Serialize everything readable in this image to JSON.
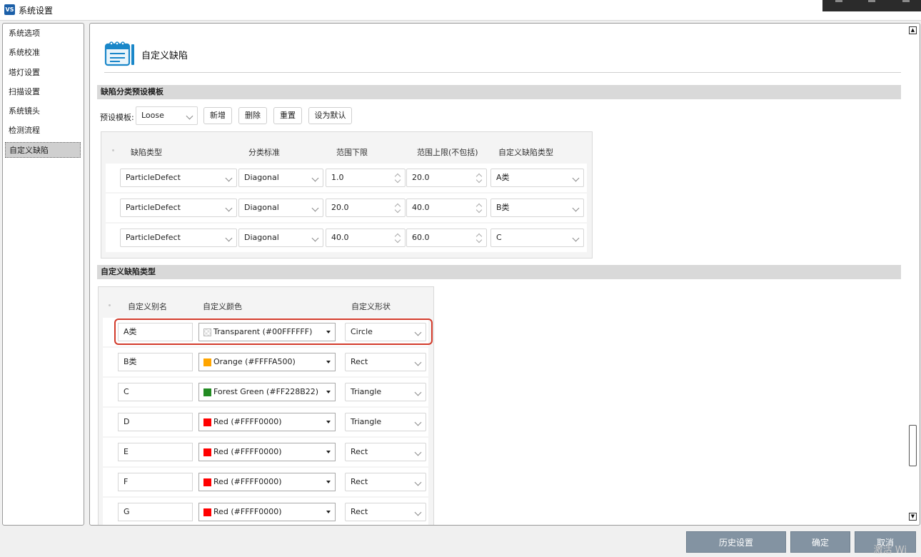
{
  "window": {
    "title": "系统设置",
    "app_badge": "VS"
  },
  "sidebar": {
    "items": [
      {
        "label": "系统选项",
        "active": false
      },
      {
        "label": "系统校准",
        "active": false
      },
      {
        "label": "塔灯设置",
        "active": false
      },
      {
        "label": "扫描设置",
        "active": false
      },
      {
        "label": "系统镜头",
        "active": false
      },
      {
        "label": "检测流程",
        "active": false
      },
      {
        "label": "自定义缺陷",
        "active": true
      }
    ]
  },
  "page": {
    "title": "自定义缺陷",
    "icon": "notepad-icon"
  },
  "preset_section": {
    "title": "缺陷分类预设模板",
    "template_label": "预设模板:",
    "template_value": "Loose",
    "buttons": {
      "add": "新增",
      "delete": "删除",
      "reset": "重置",
      "set_default": "设为默认"
    },
    "columns": [
      "缺陷类型",
      "分类标准",
      "范围下限",
      "范围上限(不包括)",
      "自定义缺陷类型"
    ],
    "rows": [
      {
        "defect_type": "ParticleDefect",
        "criterion": "Diagonal",
        "lower": "1.0",
        "upper": "20.0",
        "custom_type": "A类"
      },
      {
        "defect_type": "ParticleDefect",
        "criterion": "Diagonal",
        "lower": "20.0",
        "upper": "40.0",
        "custom_type": "B类"
      },
      {
        "defect_type": "ParticleDefect",
        "criterion": "Diagonal",
        "lower": "40.0",
        "upper": "60.0",
        "custom_type": "C"
      }
    ]
  },
  "custom_section": {
    "title": "自定义缺陷类型",
    "columns": [
      "自定义别名",
      "自定义颜色",
      "自定义形状"
    ],
    "rows": [
      {
        "alias": "A类",
        "color_label": "Transparent (#00FFFFFF)",
        "swatch": "transparent",
        "shape": "Circle",
        "highlighted": true
      },
      {
        "alias": "B类",
        "color_label": "Orange (#FFFFA500)",
        "swatch": "#FFA500",
        "shape": "Rect",
        "highlighted": false
      },
      {
        "alias": "C",
        "color_label": "Forest Green (#FF228B22)",
        "swatch": "#228B22",
        "shape": "Triangle",
        "highlighted": false
      },
      {
        "alias": "D",
        "color_label": "Red (#FFFF0000)",
        "swatch": "#FF0000",
        "shape": "Triangle",
        "highlighted": false
      },
      {
        "alias": "E",
        "color_label": "Red (#FFFF0000)",
        "swatch": "#FF0000",
        "shape": "Rect",
        "highlighted": false
      },
      {
        "alias": "F",
        "color_label": "Red (#FFFF0000)",
        "swatch": "#FF0000",
        "shape": "Rect",
        "highlighted": false
      },
      {
        "alias": "G",
        "color_label": "Red (#FFFF0000)",
        "swatch": "#FF0000",
        "shape": "Rect",
        "highlighted": false
      }
    ]
  },
  "footer": {
    "history": "历史设置",
    "ok": "确定",
    "cancel": "取消"
  },
  "watermark": "激活 Wi",
  "colors": {
    "highlight": "#d23a2a",
    "footer_button": "#8393a2",
    "section_bar": "#d9d9d9"
  }
}
